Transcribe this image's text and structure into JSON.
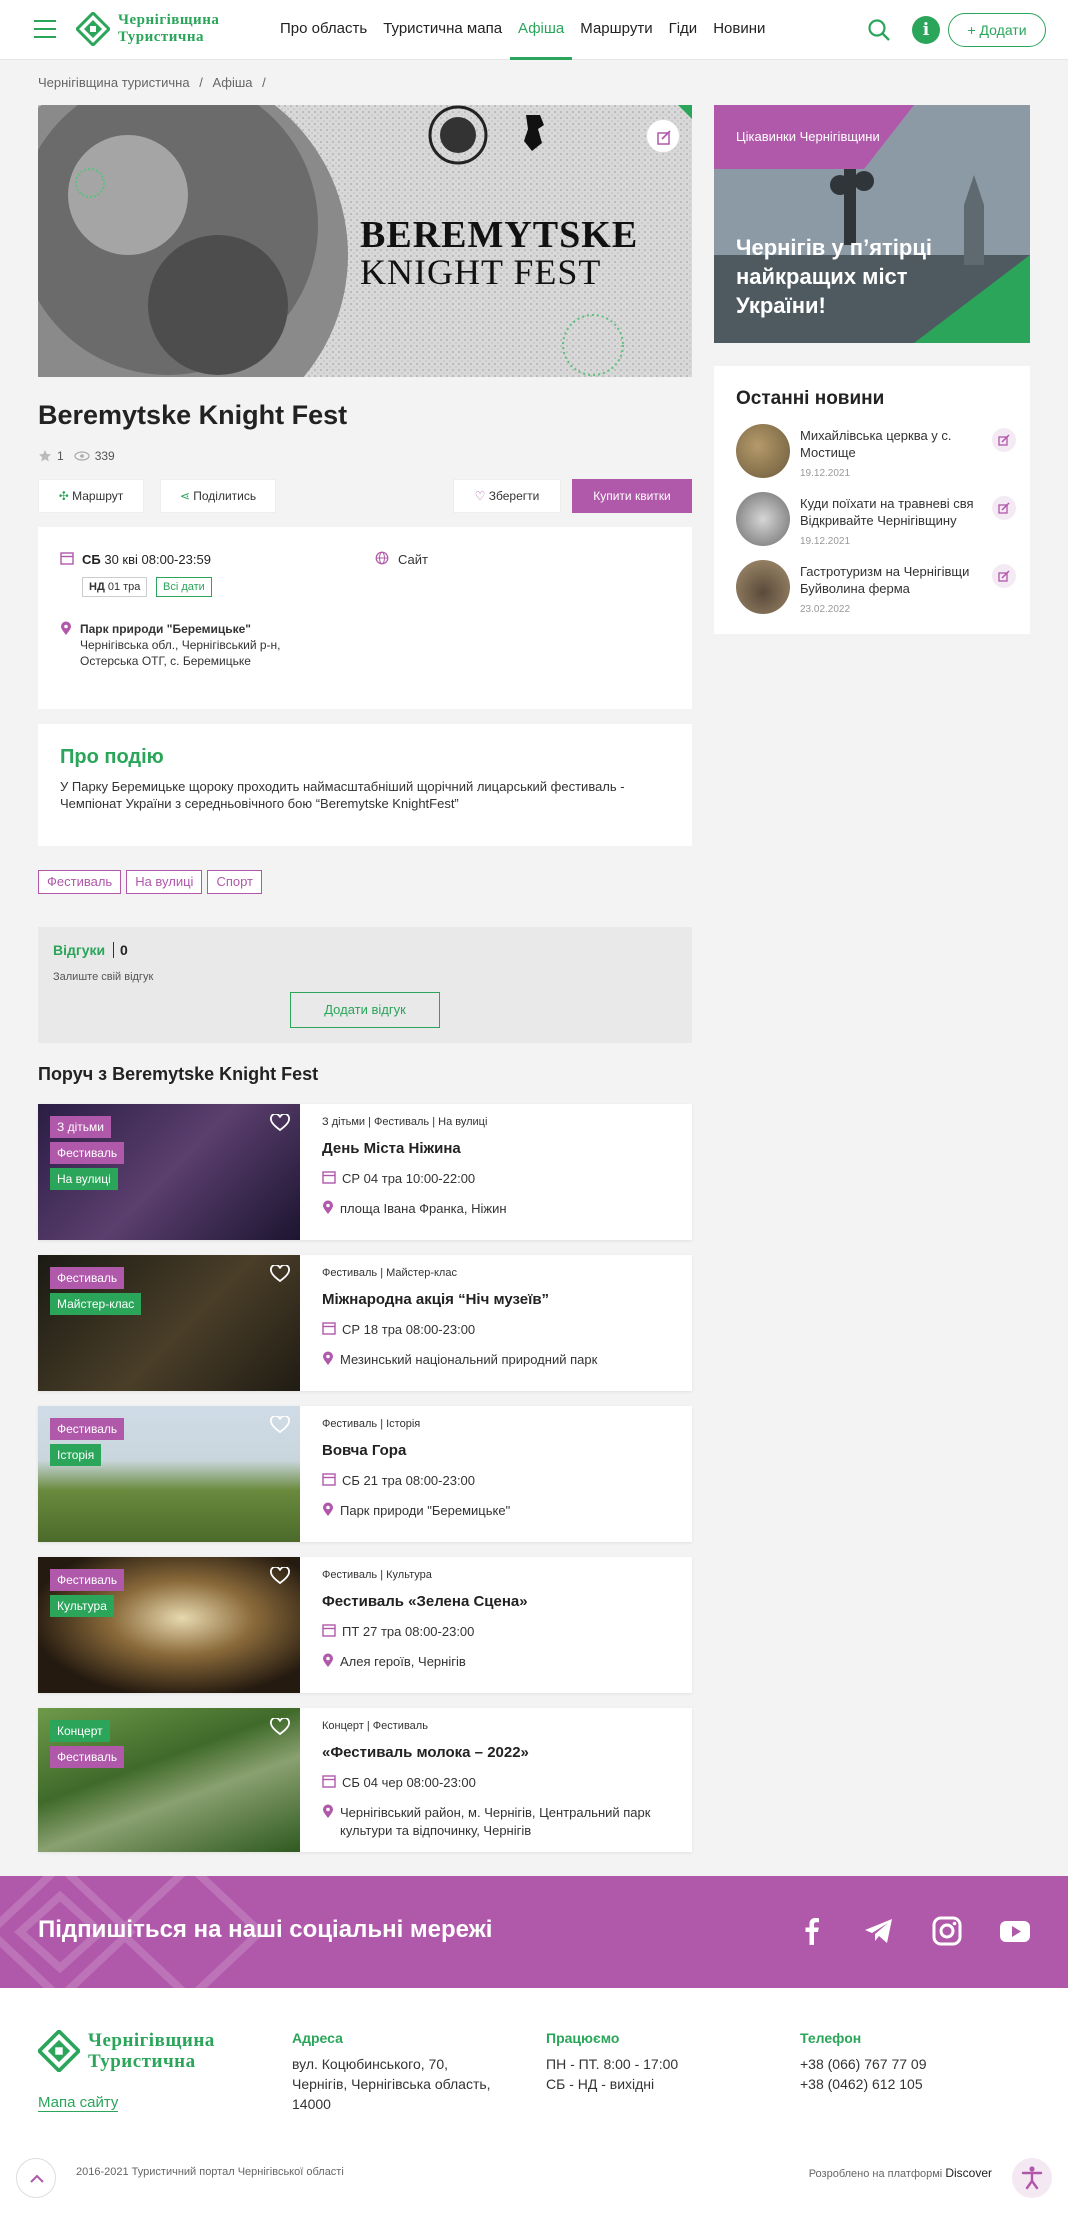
{
  "header": {
    "logo_line1": "Чернігівщина",
    "logo_line2": "Туристична",
    "nav": [
      "Про область",
      "Туристична мапа",
      "Афіша",
      "Маршрути",
      "Гіди",
      "Новини"
    ],
    "active_nav": "Афіша",
    "add_label": "Додати"
  },
  "breadcrumbs": [
    "Чернігівщина туристична",
    "/",
    "Афіша",
    "/"
  ],
  "hero": {
    "title_line1": "BEREMYTSKE",
    "title_line2": "KNIGHT FEST"
  },
  "event": {
    "title": "Beremytske Knight Fest",
    "rating": "1",
    "views": "339",
    "route_label": "Маршрут",
    "share_label": "Поділитись",
    "save_label": "Зберегти",
    "buy_label": "Купити квитки",
    "day1": "СБ",
    "date1": "30 кві 08:00-23:59",
    "day2": "НД",
    "date2": "01 тра",
    "all_dates": "Всі дати",
    "site_label": "Сайт",
    "place_name": "Парк природи \"Беремицьке\"",
    "place_addr1": "Чернігівська обл., Чернігівський р-н,",
    "place_addr2": "Остерська ОТГ, с. Беремицьке",
    "about_title": "Про подію",
    "about_text": "У Парку Беремицьке щороку проходить наймасштабніший щорічний лицарський фестиваль - Чемпіонат України з середньовічного бою “Beremytske KnightFest”",
    "tags": [
      "Фестиваль",
      "На вулиці",
      "Спорт"
    ]
  },
  "reviews": {
    "title": "Відгуки",
    "count": "0",
    "hint": "Залиште свій відгук",
    "add_label": "Додати відгук"
  },
  "sidebar": {
    "promo_badge": "Цікавинки Чернігівщини",
    "promo_title": "Чернігів у п’ятірці найкращих міст України!",
    "news_title": "Останні новини",
    "news": [
      {
        "title1": "Михайлівська церква у с.",
        "title2": "Мостище",
        "date": "19.12.2021"
      },
      {
        "title1": "Куди поїхати на травневі свя",
        "title2": "Відкривайте Чернігівщину",
        "date": "19.12.2021"
      },
      {
        "title1": "Гастротуризм на Чернігівщи",
        "title2": "Буйволина ферма",
        "date": "23.02.2022"
      }
    ]
  },
  "nearby_title": "Поруч з Beremytske Knight Fest",
  "nearby": [
    {
      "badges": [
        "З дітьми",
        "Фестиваль",
        "На вулиці"
      ],
      "cat": "З дітьми | Фестиваль | На вулиці",
      "name": "День Міста Ніжина",
      "date": "СР 04 тра 10:00-22:00",
      "place": "площа Івана Франка, Ніжин"
    },
    {
      "badges": [
        "Фестиваль",
        "Майстер-клас"
      ],
      "cat": "Фестиваль | Майстер-клас",
      "name": "Міжнародна акція “Ніч музеїв”",
      "date": "СР 18 тра 08:00-23:00",
      "place": "Мезинський національний природний парк"
    },
    {
      "badges": [
        "Фестиваль",
        "Історія"
      ],
      "cat": "Фестиваль | Історія",
      "name": "Вовча Гора",
      "date": "СБ 21 тра 08:00-23:00",
      "place": "Парк природи \"Беремицьке\""
    },
    {
      "badges": [
        "Фестиваль",
        "Культура"
      ],
      "cat": "Фестиваль | Культура",
      "name": "Фестиваль «Зелена Сцена»",
      "date": "ПТ 27 тра 08:00-23:00",
      "place": "Алея героїв, Чернігів"
    },
    {
      "badges": [
        "Концерт",
        "Фестиваль"
      ],
      "cat": "Концерт | Фестиваль",
      "name": "«Фестиваль молока – 2022»",
      "date": "СБ 04 чер 08:00-23:00",
      "place1": "Чернігівський район, м. Чернігів, Центральний парк",
      "place2": "культури та відпочинку, Чернігів"
    }
  ],
  "social": {
    "title": "Підпишіться на наші соціальні мережі"
  },
  "footer": {
    "sitemap": "Мапа сайту",
    "address_title": "Адреса",
    "address": [
      "вул. Коцюбинського, 70,",
      "Чернігів, Чернігівська область,",
      "14000"
    ],
    "hours_title": "Працюємо",
    "hours": [
      "ПН - ПТ. 8:00 - 17:00",
      "СБ - НД - вихідні"
    ],
    "phone_title": "Телефон",
    "phones": [
      "+38 (066) 767 77 09",
      "+38 (0462) 612 105"
    ],
    "copyright": "2016-2021 Туристичний портал Чернігівської області",
    "made_prefix": "Розроблено на платформі",
    "made_brand": "Discover"
  },
  "colors": {
    "green": "#2aa55a",
    "purple": "#b058aa"
  }
}
